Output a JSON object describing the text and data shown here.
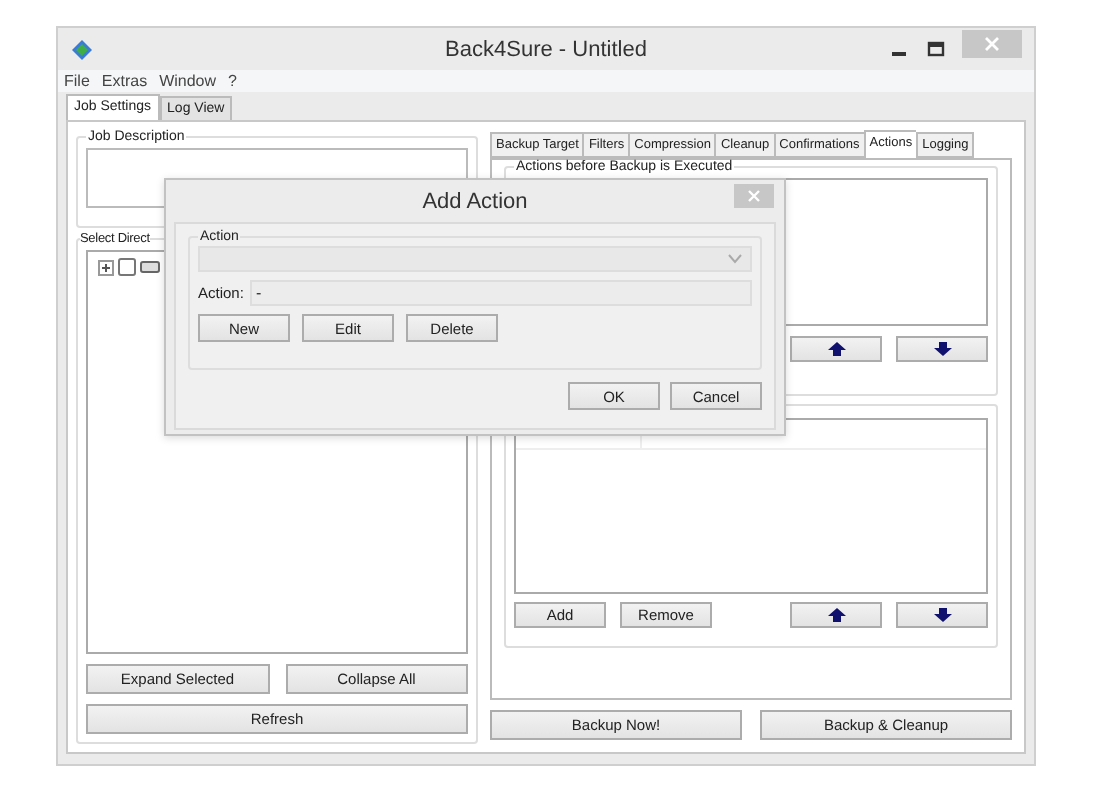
{
  "window": {
    "title": "Back4Sure - Untitled"
  },
  "menu": [
    "File",
    "Extras",
    "Window",
    "?"
  ],
  "main_tabs": [
    {
      "label": "Job Settings",
      "selected": true
    },
    {
      "label": "Log View",
      "selected": false
    }
  ],
  "job_description": {
    "label": "Job Description"
  },
  "directories": {
    "label": "Select Direct",
    "tree": [
      {
        "expanded": false,
        "checked": false
      }
    ],
    "buttons": [
      "Expand Selected",
      "Collapse All"
    ],
    "refresh": "Refresh"
  },
  "settings_tabs": [
    {
      "label": "Backup Target",
      "selected": false
    },
    {
      "label": "Filters",
      "selected": false
    },
    {
      "label": "Compression",
      "selected": false
    },
    {
      "label": "Cleanup",
      "selected": false
    },
    {
      "label": "Confirmations",
      "selected": false
    },
    {
      "label": "Actions",
      "selected": true
    },
    {
      "label": "Logging",
      "selected": false
    }
  ],
  "before_actions": {
    "label": "Actions before Backup is Executed"
  },
  "after_actions": {
    "buttons": [
      "Add",
      "Remove"
    ]
  },
  "bottom_buttons": [
    "Backup Now!",
    "Backup & Cleanup"
  ],
  "dialog": {
    "title": "Add Action",
    "group": "Action",
    "combo": {
      "disabled": true
    },
    "field": {
      "label": "Action:",
      "value": "-"
    },
    "buttons": [
      "New",
      "Edit",
      "Delete"
    ],
    "actions": [
      "OK",
      "Cancel"
    ]
  }
}
